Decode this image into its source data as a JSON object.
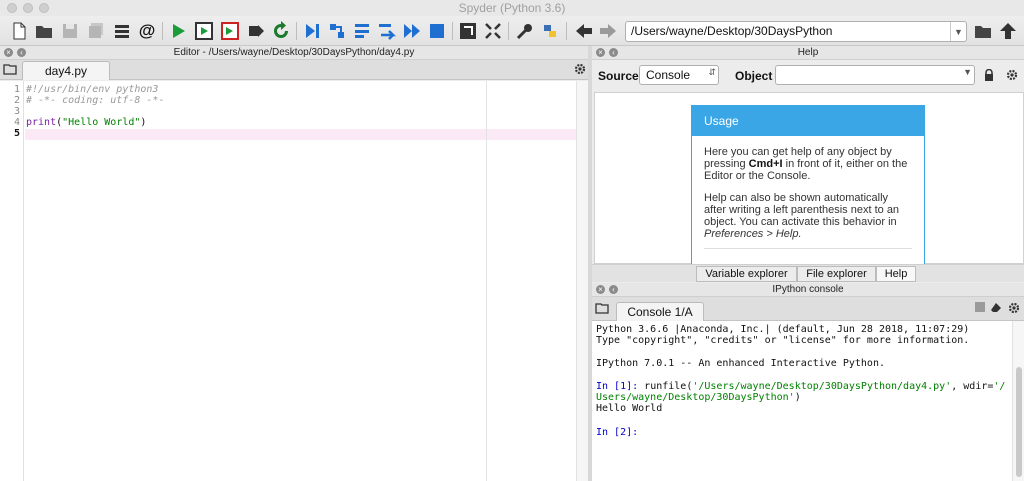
{
  "window": {
    "title": "Spyder (Python 3.6)"
  },
  "toolbar": {
    "icons": [
      "new-file-icon",
      "open-file-icon",
      "save-icon",
      "save-all-icon",
      "list-icon",
      "at-icon",
      "run-icon",
      "run-cell-icon",
      "run-cell-advance-icon",
      "run-selection-icon",
      "rerun-icon",
      "debug-icon",
      "step-icon",
      "step-into-icon",
      "step-return-icon",
      "continue-icon",
      "stop-icon",
      "maximize-pane-icon",
      "fullscreen-icon",
      "wrench-icon",
      "python-path-icon",
      "back-arrow-icon",
      "forward-arrow-icon",
      "browse-folder-icon",
      "parent-dir-icon"
    ],
    "working_dir": "/Users/wayne/Desktop/30DaysPython"
  },
  "editor": {
    "header": "Editor - /Users/wayne/Desktop/30DaysPython/day4.py",
    "tab": "day4.py",
    "line_numbers": [
      "1",
      "2",
      "3",
      "4",
      "5"
    ],
    "lines": {
      "l1": "#!/usr/bin/env python3",
      "l2": "# -*- coding: utf-8 -*-",
      "l3": "",
      "l4_func": "print",
      "l4_open": "(",
      "l4_str": "\"Hello World\"",
      "l4_close": ")",
      "l5": ""
    }
  },
  "help": {
    "header": "Help",
    "source_label": "Source",
    "source_value": "Console",
    "object_label": "Object",
    "object_value": "",
    "usage_title": "Usage",
    "usage_p1_a": "Here you can get help of any object by pressing ",
    "usage_p1_b": "Cmd+I",
    "usage_p1_c": " in front of it, either on the Editor or the Console.",
    "usage_p2_a": "Help can also be shown automatically after writing a left parenthesis next to an object. You can activate this behavior in ",
    "usage_p2_b": "Preferences > Help.",
    "tabs": [
      "Variable explorer",
      "File explorer",
      "Help"
    ],
    "selected_tab": "Help"
  },
  "console": {
    "header": "IPython console",
    "tab": "Console 1/A",
    "banner1": "Python 3.6.6 |Anaconda, Inc.| (default, Jun 28 2018, 11:07:29)",
    "banner2": "Type \"copyright\", \"credits\" or \"license\" for more information.",
    "banner3": "IPython 7.0.1 -- An enhanced Interactive Python.",
    "in1_prompt": "In [1]:",
    "in1_cmd_a": " runfile(",
    "in1_str1": "'/Users/wayne/Desktop/30DaysPython/day4.py'",
    "in1_cmd_b": ", wdir=",
    "in1_str2a": "'/",
    "in1_str2b": "Users/wayne/Desktop/30DaysPython'",
    "in1_cmd_c": ")",
    "output": "Hello World",
    "in2_prompt": "In [2]:"
  },
  "colors": {
    "accent": "#3ba6e6",
    "run_green": "#1a9c3a",
    "prompt_blue": "#0000cc",
    "string_green": "#008000",
    "current_line": "#fbe9f5"
  }
}
